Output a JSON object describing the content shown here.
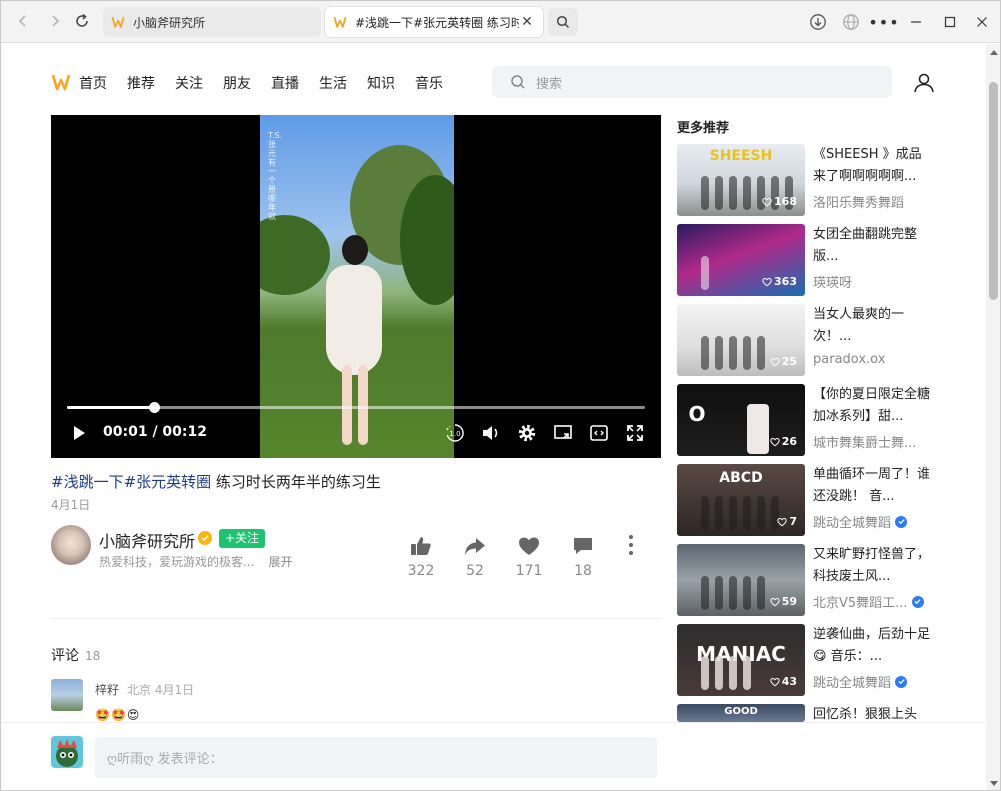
{
  "browser": {
    "tabs": [
      {
        "title": "小脑斧研究所",
        "active": false
      },
      {
        "title": "#浅跳一下#张元英转圈 练习时长两年半的练习生",
        "active": true
      }
    ]
  },
  "site": {
    "nav": [
      "首页",
      "推荐",
      "关注",
      "朋友",
      "直播",
      "生活",
      "知识",
      "音乐"
    ],
    "search_placeholder": "搜索",
    "brand_color": "#f5a623"
  },
  "video": {
    "current_time": "00:01",
    "duration": "00:12",
    "time_display": "00:01 / 00:12",
    "progress": 0.15,
    "speed_label": "1.0",
    "overlay_text": "T.S.张元 有一个原 哪年就",
    "title_tags": "#浅跳一下#张元英转圈",
    "title_text": " 练习时长两年半的练习生",
    "date": "4月1日"
  },
  "author": {
    "name": "小脑斧研究所",
    "follow_label": "+关注",
    "bio": "热爱科技，爱玩游戏的极客...",
    "expand_label": "展开"
  },
  "stats": {
    "likes": "322",
    "shares": "52",
    "favorites": "171",
    "comments": "18"
  },
  "comments": {
    "header": "评论",
    "count": "18",
    "items": [
      {
        "user": "梓籽",
        "meta": "北京 4月1日",
        "text": "🤩🤩😍"
      }
    ],
    "input_placeholder": "ღ听雨ღ 发表评论："
  },
  "sidebar": {
    "title": "更多推荐",
    "items": [
      {
        "title": "《SHEESH 》成品来了啊啊啊啊啊...",
        "author": "洛阳乐舞秀舞蹈",
        "likes": "168",
        "verified": false
      },
      {
        "title": "女团全曲翻跳完整版...",
        "author": "瑛瑛呀",
        "likes": "363",
        "verified": false
      },
      {
        "title": "当女人最爽的一次！...",
        "author": "paradox.ox",
        "likes": "25",
        "verified": false
      },
      {
        "title": "【你的夏日限定全糖加冰系列】甜...",
        "author": "城市舞集爵士舞...",
        "likes": "26",
        "verified": false
      },
      {
        "title": "单曲循环一周了！谁还没跳！ 音...",
        "author": "跳动全城舞蹈",
        "likes": "7",
        "verified": true
      },
      {
        "title": "又来旷野打怪兽了，科技废土风...",
        "author": "北京V5舞蹈工...",
        "likes": "59",
        "verified": true
      },
      {
        "title": "逆袭仙曲，后劲十足😋 音乐：...",
        "author": "跳动全城舞蹈",
        "likes": "43",
        "verified": true
      },
      {
        "title": "回忆杀！狠狠上头",
        "author": "",
        "likes": "",
        "verified": false
      }
    ],
    "thumb_texts": [
      "SHEESH",
      "",
      "",
      "O",
      "ABCD",
      "",
      "MANIAC",
      "GOOD"
    ]
  }
}
